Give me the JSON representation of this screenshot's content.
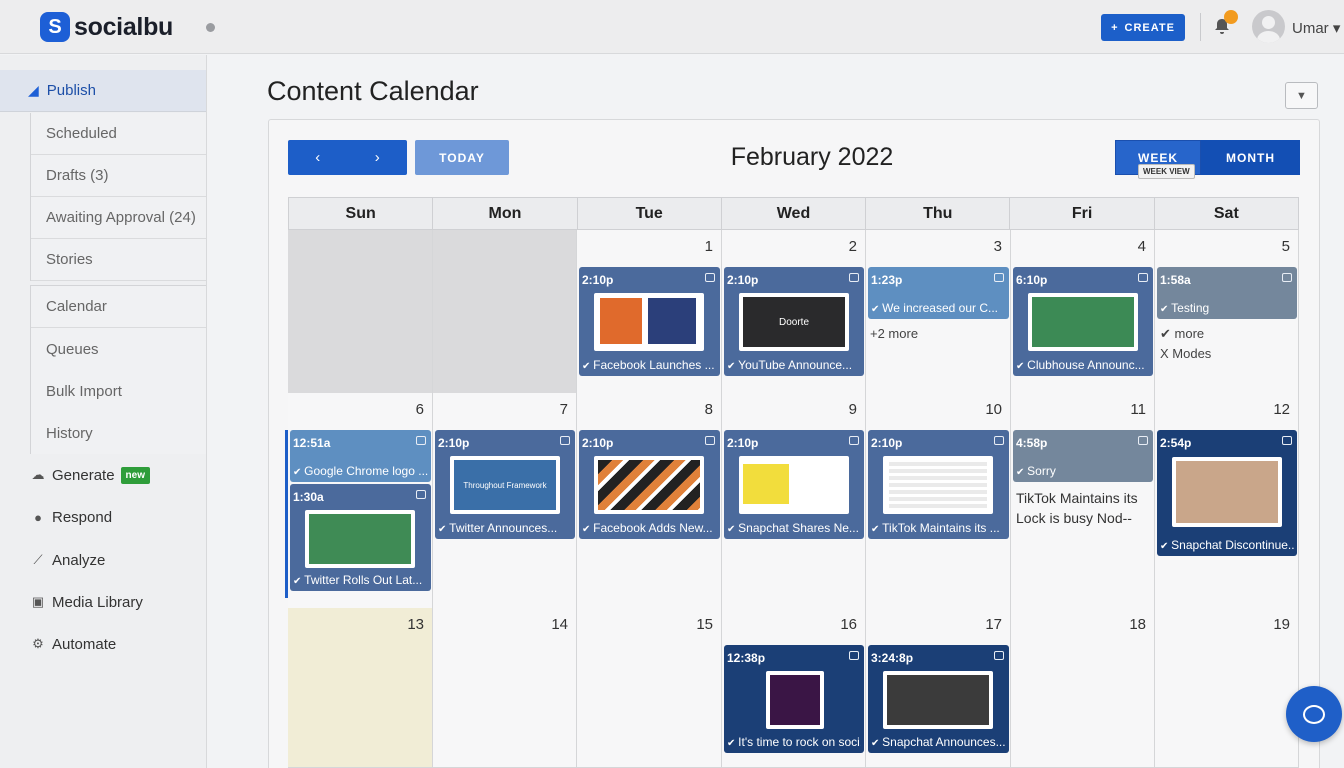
{
  "brand": {
    "logo_letter": "S",
    "name": "socialbu",
    "accent": "#1d5fd6"
  },
  "header": {
    "create_label": "CREATE",
    "user_name": "Umar ▾"
  },
  "sidebar": {
    "publish": "Publish",
    "publish_sub": [
      "Scheduled",
      "Drafts (3)",
      "Awaiting Approval (24)",
      "Stories"
    ],
    "calendar_sub": [
      "Calendar",
      "Queues",
      "Bulk Import",
      "History"
    ],
    "main": [
      {
        "label": "Generate",
        "icon": "brain-icon"
      },
      {
        "label": "Respond",
        "icon": "chat-icon"
      },
      {
        "label": "Analyze",
        "icon": "chart-icon"
      },
      {
        "label": "Media Library",
        "icon": "media-icon"
      },
      {
        "label": "Automate",
        "icon": "gears-icon"
      }
    ],
    "new_badge": "new"
  },
  "main": {
    "title": "Content Calendar",
    "today_label": "TODAY",
    "month_title": "February 2022",
    "week_label": "WEEK",
    "month_label": "MONTH",
    "tooltip": "WEEK VIEW",
    "weekdays": [
      "Sun",
      "Mon",
      "Tue",
      "Wed",
      "Thu",
      "Fri",
      "Sat"
    ]
  },
  "calendar": {
    "days": [
      "1",
      "2",
      "3",
      "4",
      "5",
      "6",
      "7",
      "8",
      "9",
      "10",
      "11",
      "12",
      "13",
      "14",
      "15",
      "16",
      "17",
      "18",
      "19"
    ],
    "events": [
      {
        "time": "2:10p",
        "caption": "Facebook Launches ..."
      },
      {
        "time": "2:10p",
        "caption": "YouTube Announce..."
      },
      {
        "time": "1:23p",
        "caption": "We increased our C..."
      },
      {
        "time": "6:10p",
        "caption": "Clubhouse Announc..."
      },
      {
        "time": "1:58a",
        "caption": "Testing"
      },
      {
        "time": "12:51a",
        "caption": "Google Chrome logo ..."
      },
      {
        "time": "1:30a",
        "caption": "Twitter Rolls Out Lat..."
      },
      {
        "time": "2:10p",
        "caption": "Twitter Announces..."
      },
      {
        "time": "2:10p",
        "caption": "Facebook Adds New..."
      },
      {
        "time": "2:10p",
        "caption": "Snapchat Shares Ne..."
      },
      {
        "time": "2:10p",
        "caption": "TikTok Maintains its ..."
      },
      {
        "time": "4:58p",
        "caption": "Sorry"
      },
      {
        "time": "2:54p",
        "caption": "Snapchat Discontinue..."
      },
      {
        "time": "12:38p",
        "caption": "It's time to rock on soci..."
      },
      {
        "time": "3:24:8p",
        "caption": "Snapchat Announces..."
      }
    ],
    "more_wed": "+2 more",
    "more_sat": "✔ more",
    "x_more_sat": "X Modes",
    "fri_text": "TikTok Maintains its Lock is busy Nod--",
    "thumb_text": {
      "ev2": "Doorte",
      "ev8": "Throughout Framework"
    }
  }
}
